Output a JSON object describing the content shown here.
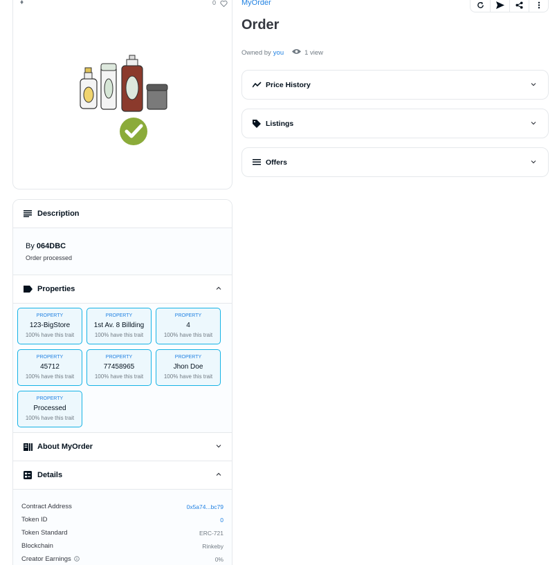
{
  "media": {
    "favorite_count": "0"
  },
  "description": {
    "heading": "Description",
    "by_prefix": "By",
    "creator": "064DBC",
    "text": "Order processed"
  },
  "properties": {
    "heading": "Properties",
    "items": [
      {
        "type": "PROPERTY",
        "value": "123-BigStore",
        "rarity": "100% have this trait"
      },
      {
        "type": "PROPERTY",
        "value": "1st Av. 8 Billding",
        "rarity": "100% have this trait"
      },
      {
        "type": "PROPERTY",
        "value": "4",
        "rarity": "100% have this trait"
      },
      {
        "type": "PROPERTY",
        "value": "45712",
        "rarity": "100% have this trait"
      },
      {
        "type": "PROPERTY",
        "value": "77458965",
        "rarity": "100% have this trait"
      },
      {
        "type": "PROPERTY",
        "value": "Jhon Doe",
        "rarity": "100% have this trait"
      },
      {
        "type": "PROPERTY",
        "value": "Processed",
        "rarity": "100% have this trait"
      }
    ]
  },
  "about": {
    "heading": "About MyOrder"
  },
  "details": {
    "heading": "Details",
    "rows": [
      {
        "label": "Contract Address",
        "value": "0x5a74...bc79"
      },
      {
        "label": "Token ID",
        "value": "0"
      },
      {
        "label": "Token Standard",
        "value": "ERC-721"
      },
      {
        "label": "Blockchain",
        "value": "Rinkeby"
      },
      {
        "label": "Creator Earnings",
        "value": "0%"
      }
    ]
  },
  "item": {
    "collection": "MyOrder",
    "title": "Order",
    "owned_by": "Owned by",
    "owner": "you",
    "views": "1 view"
  },
  "accordions": {
    "price_history": "Price History",
    "listings": "Listings",
    "offers": "Offers"
  },
  "colors": {
    "link": "#2081e2",
    "property_border": "#15b2e5",
    "check_green": "#8bab3a"
  }
}
